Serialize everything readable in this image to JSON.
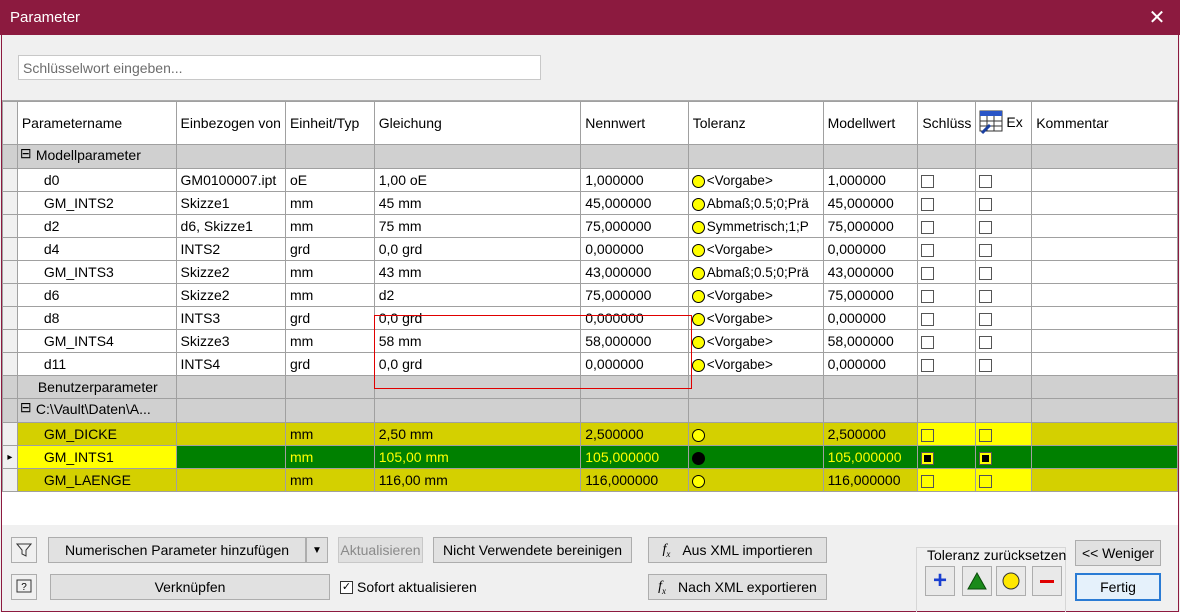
{
  "window": {
    "title": "Parameter",
    "close_glyph": "✕"
  },
  "search": {
    "placeholder": "Schlüsselwort eingeben..."
  },
  "columns": [
    "Parametername",
    "Einbezogen von",
    "Einheit/Typ",
    "Gleichung",
    "Nennwert",
    "Toleranz",
    "Modellwert",
    "Schlüss",
    "Ex",
    "Kommentar"
  ],
  "groups": {
    "model": "Modellparameter",
    "user": "Benutzerparameter",
    "vault": "C:\\Vault\\Daten\\A..."
  },
  "model_rows": [
    {
      "name": "d0",
      "used_by": "GM0100007.ipt",
      "unit": "oE",
      "equation": "1,00 oE",
      "nominal": "1,000000",
      "tolerance": "<Vorgabe>",
      "model_value": "1,000000"
    },
    {
      "name": "GM_INTS2",
      "used_by": "Skizze1",
      "unit": "mm",
      "equation": "45 mm",
      "nominal": "45,000000",
      "tolerance": "Abmaß;0.5;0;Prä",
      "model_value": "45,000000"
    },
    {
      "name": "d2",
      "used_by": "d6, Skizze1",
      "unit": "mm",
      "equation": "75 mm",
      "nominal": "75,000000",
      "tolerance": "Symmetrisch;1;P",
      "model_value": "75,000000"
    },
    {
      "name": "d4",
      "used_by": "INTS2",
      "unit": "grd",
      "equation": "0,0 grd",
      "nominal": "0,000000",
      "tolerance": "<Vorgabe>",
      "model_value": "0,000000"
    },
    {
      "name": "GM_INTS3",
      "used_by": "Skizze2",
      "unit": "mm",
      "equation": "43 mm",
      "nominal": "43,000000",
      "tolerance": "Abmaß;0.5;0;Prä",
      "model_value": "43,000000"
    },
    {
      "name": "d6",
      "used_by": "Skizze2",
      "unit": "mm",
      "equation": "d2",
      "nominal": "75,000000",
      "tolerance": "<Vorgabe>",
      "model_value": "75,000000"
    },
    {
      "name": "d8",
      "used_by": "INTS3",
      "unit": "grd",
      "equation": "0,0 grd",
      "nominal": "0,000000",
      "tolerance": "<Vorgabe>",
      "model_value": "0,000000"
    },
    {
      "name": "GM_INTS4",
      "used_by": "Skizze3",
      "unit": "mm",
      "equation": "58 mm",
      "nominal": "58,000000",
      "tolerance": "<Vorgabe>",
      "model_value": "58,000000"
    },
    {
      "name": "d11",
      "used_by": "INTS4",
      "unit": "grd",
      "equation": "0,0 grd",
      "nominal": "0,000000",
      "tolerance": "<Vorgabe>",
      "model_value": "0,000000"
    }
  ],
  "vault_rows": [
    {
      "name": "GM_DICKE",
      "unit": "mm",
      "equation": "2,50 mm",
      "nominal": "2,500000",
      "model_value": "2,500000"
    },
    {
      "name": "GM_INTS1",
      "unit": "mm",
      "equation": "105,00 mm",
      "nominal": "105,000000",
      "model_value": "105,000000"
    },
    {
      "name": "GM_LAENGE",
      "unit": "mm",
      "equation": "116,00 mm",
      "nominal": "116,000000",
      "model_value": "116,000000"
    }
  ],
  "buttons": {
    "add_numeric": "Numerischen Parameter hinzufügen",
    "update": "Aktualisieren",
    "purge_unused": "Nicht Verwendete bereinigen",
    "import_xml": "Aus XML importieren",
    "link": "Verknüpfen",
    "immediate_update": "Sofort aktualisieren",
    "export_xml": "Nach XML exportieren",
    "less": "<< Weniger",
    "done": "Fertig"
  },
  "tolerance_reset": {
    "label": "Toleranz zurücksetzen"
  },
  "colors": {
    "title_bar": "#8c1a3f",
    "selected_row": "#008000",
    "highlight_row": "#d4d000",
    "highlight_frame": "#e00000"
  }
}
